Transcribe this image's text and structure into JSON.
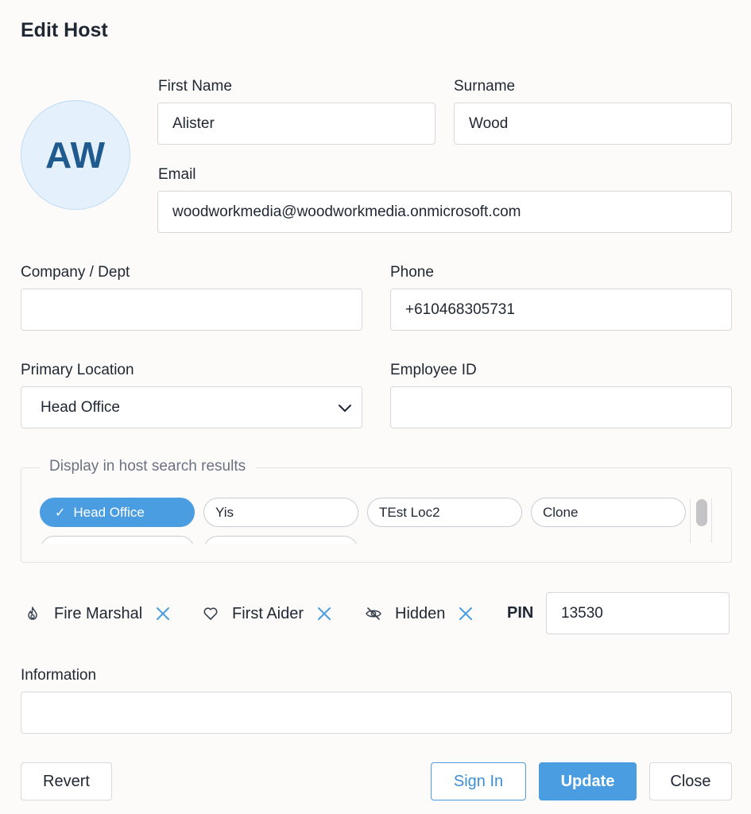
{
  "dialog": {
    "title": "Edit Host"
  },
  "avatar": {
    "initials": "AW"
  },
  "fields": {
    "first_name": {
      "label": "First Name",
      "value": "Alister"
    },
    "surname": {
      "label": "Surname",
      "value": "Wood"
    },
    "email": {
      "label": "Email",
      "value": "woodworkmedia@woodworkmedia.onmicrosoft.com"
    },
    "company": {
      "label": "Company / Dept",
      "value": ""
    },
    "phone": {
      "label": "Phone",
      "value": "+610468305731"
    },
    "primary_location": {
      "label": "Primary Location",
      "value": "Head Office"
    },
    "employee_id": {
      "label": "Employee ID",
      "value": ""
    },
    "information": {
      "label": "Information",
      "value": ""
    }
  },
  "host_search": {
    "legend": "Display in host search results",
    "locations": [
      {
        "label": "Head Office",
        "selected": true
      },
      {
        "label": "Yis",
        "selected": false
      },
      {
        "label": "TEst Loc2",
        "selected": false
      },
      {
        "label": "Clone",
        "selected": false
      }
    ]
  },
  "flags": {
    "fire_marshal": {
      "label": "Fire Marshal",
      "icon": "flame-icon"
    },
    "first_aider": {
      "label": "First Aider",
      "icon": "heart-icon"
    },
    "hidden": {
      "label": "Hidden",
      "icon": "eye-off-icon"
    }
  },
  "pin": {
    "label": "PIN",
    "value": "13530"
  },
  "buttons": {
    "revert": "Revert",
    "sign_in": "Sign In",
    "update": "Update",
    "close": "Close"
  },
  "colors": {
    "accent": "#4a9de0",
    "avatar_bg": "#e4f1fc",
    "avatar_text": "#1f5b8e"
  }
}
